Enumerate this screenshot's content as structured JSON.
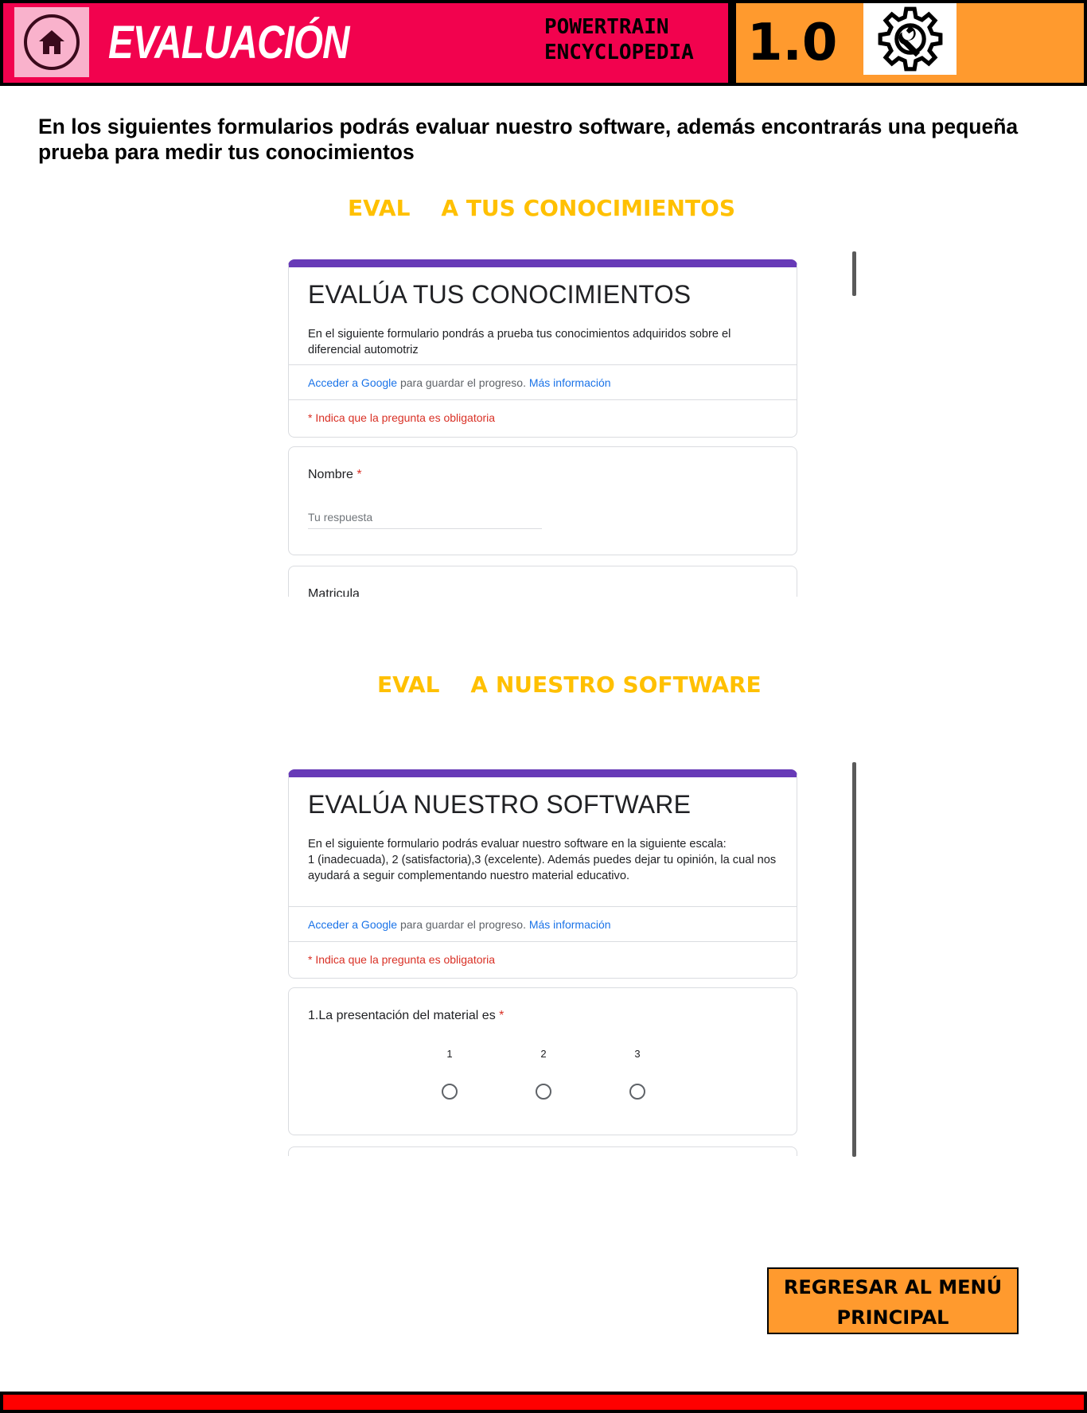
{
  "header": {
    "title": "EVALUACIÓN",
    "brand_line1": "POWERTRAIN",
    "brand_line2": "ENCYCLOPEDIA",
    "version": "1.0",
    "home_icon": "home-icon",
    "settings_icon": "gear-wrench-icon"
  },
  "colors": {
    "header_pink": "#f2024e",
    "header_orange": "#ff9a2e",
    "section_title": "#ffc000",
    "form_accent": "#673ab7",
    "footer_red": "#ff0000"
  },
  "intro": "En los siguientes formularios podrás evaluar nuestro software, además encontrarás  una pequeña prueba para medir tus conocimientos",
  "sections": [
    {
      "title": "EVAL    A TUS CONOCIMIENTOS"
    },
    {
      "title": "EVAL    A NUESTRO SOFTWARE"
    }
  ],
  "form1": {
    "title": "EVALÚA TUS CONOCIMIENTOS",
    "description": "En el siguiente formulario pondrás a prueba tus conocimientos adquiridos sobre el diferencial automotriz",
    "signin_link": "Acceder a Google",
    "signin_text": " para guardar el progreso. ",
    "more_info": "Más información",
    "required_note": "* Indica que la pregunta es obligatoria",
    "q1_label": "Nombre",
    "q1_star": " *",
    "q1_placeholder": "Tu respuesta",
    "q2_label": "Matricula"
  },
  "form2": {
    "title": "EVALÚA NUESTRO SOFTWARE",
    "description_line1": "En el siguiente formulario podrás evaluar nuestro software en la siguiente escala:",
    "description_line2": "1 (inadecuada), 2 (satisfactoria),3 (excelente). Además puedes dejar tu opinión, la cual nos ayudará a seguir complementando nuestro material educativo.",
    "signin_link": "Acceder a Google",
    "signin_text": " para guardar el progreso. ",
    "more_info": "Más información",
    "required_note": "* Indica que la pregunta es obligatoria",
    "q1_label": "1.La presentación del material es",
    "q1_star": " *",
    "scale": [
      "1",
      "2",
      "3"
    ]
  },
  "back_button": {
    "line1": "REGRESAR AL MENÚ",
    "line2": "PRINCIPAL"
  }
}
